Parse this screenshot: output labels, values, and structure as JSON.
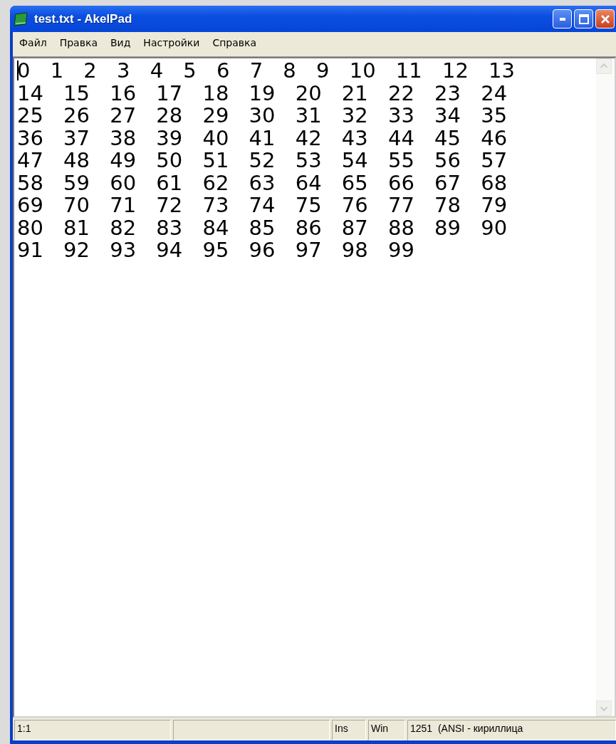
{
  "window": {
    "title": "test.txt - AkelPad"
  },
  "menu": [
    "Файл",
    "Правка",
    "Вид",
    "Настройки",
    "Справка"
  ],
  "editor": {
    "lines": [
      "0 1 2 3 4 5 6 7 8 9 10 11 12 13",
      "14 15 16 17 18 19 20 21 22 23 24",
      "25 26 27 28 29 30 31 32 33 34 35",
      "36 37 38 39 40 41 42 43 44 45 46",
      "47 48 49 50 51 52 53 54 55 56 57",
      "58 59 60 61 62 63 64 65 66 67 68",
      "69 70 71 72 73 74 75 76 77 78 79",
      "80 81 82 83 84 85 86 87 88 89 90",
      "91 92 93 94 95 96 97 98 99"
    ]
  },
  "status_bar": {
    "position": "1:1",
    "mode": "Ins",
    "newline": "Win",
    "codepage": "1251  (ANSI - кириллица"
  }
}
